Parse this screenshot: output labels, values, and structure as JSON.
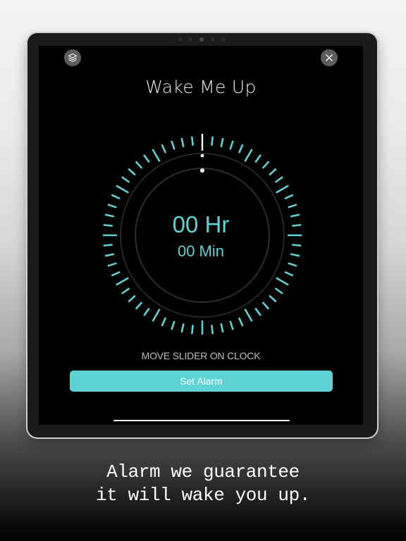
{
  "app": {
    "title": "Wake Me Up"
  },
  "buttons": {
    "layers_icon": "layers-icon",
    "close_icon": "close-icon",
    "set_alarm_label": "Set Alarm"
  },
  "timer": {
    "hours_text": "00 Hr",
    "minutes_text": "00 Min",
    "hint": "MOVE SLIDER ON CLOCK",
    "hours": 0,
    "minutes": 0
  },
  "caption": {
    "line1": "Alarm we guarantee",
    "line2": "it will wake you up."
  },
  "colors": {
    "accent": "#5ed3d5",
    "screen_bg": "#000000",
    "title_text": "#e9e9e9",
    "hint_text": "#bdbdbd"
  }
}
